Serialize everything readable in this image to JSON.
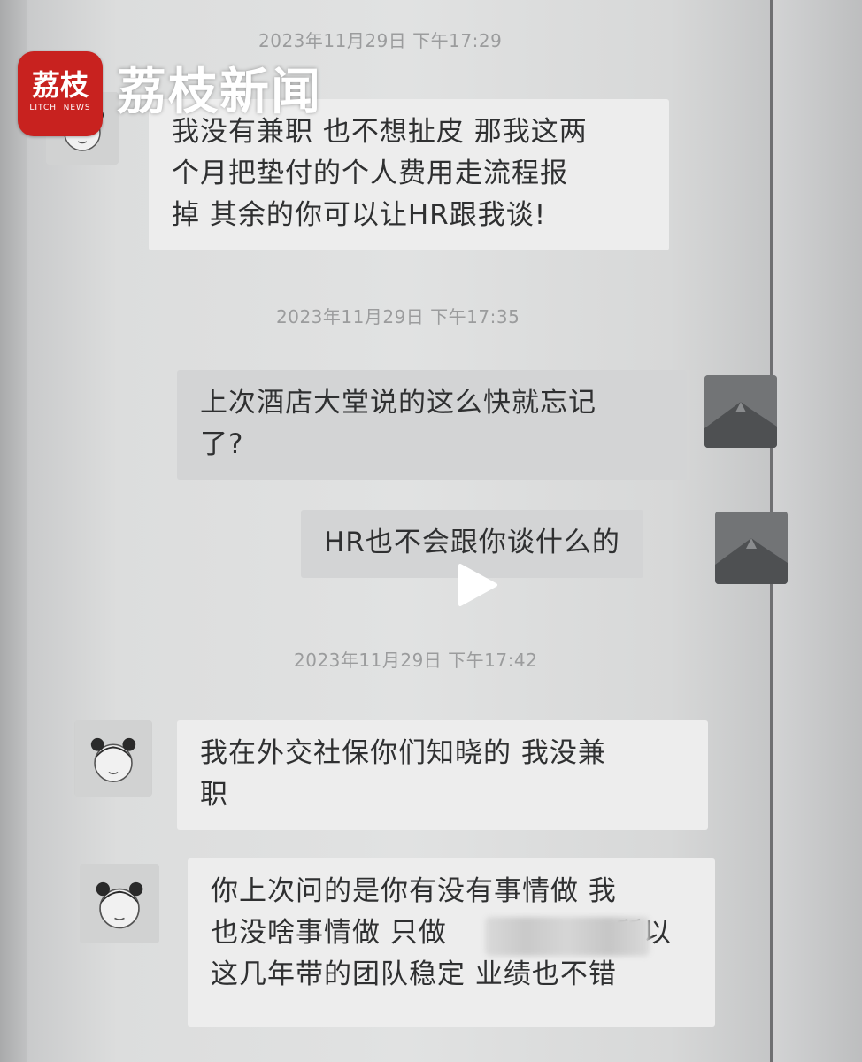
{
  "brand": {
    "logo_text": "荔枝",
    "logo_subtext": "LITCHI NEWS",
    "name": "荔枝新闻"
  },
  "chat": {
    "messages": [
      {
        "timestamp": "2023年11月29日 下午17:29",
        "sender": "other",
        "lines": [
          "我没有兼职 也不想扯皮 那我这两",
          "个月把垫付的个人费用走流程报",
          "掉 其余的你可以让HR跟我谈!"
        ]
      },
      {
        "timestamp": "2023年11月29日 下午17:35",
        "sender": "me",
        "lines": [
          "上次酒店大堂说的这么快就忘记",
          "了?"
        ]
      },
      {
        "sender": "me",
        "lines": [
          "HR也不会跟你谈什么的"
        ]
      },
      {
        "timestamp": "2023年11月29日 下午17:42",
        "sender": "other",
        "lines": [
          "我在外交社保你们知晓的 我没兼",
          "职"
        ]
      },
      {
        "sender": "other",
        "lines": [
          "你上次问的是你有没有事情做 我",
          "也没啥事情做 只做",
          "这几年带的团队稳定 业绩也不错"
        ],
        "trailing_fragment": "所以"
      }
    ]
  },
  "player": {
    "play_icon": "play-icon"
  },
  "colors": {
    "brand_red": "#c8221f",
    "bubble_other": "#ededed",
    "bubble_me": "#d3d4d5"
  }
}
